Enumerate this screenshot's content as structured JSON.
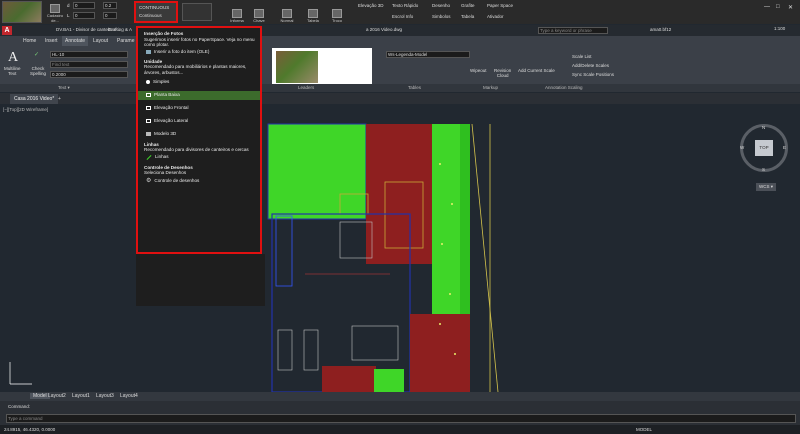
{
  "top": {
    "cmd_labels": [
      "Cadastro\nde...",
      "Mosaicos"
    ],
    "field_d": "d",
    "field_d_val": "0",
    "field_l": "L",
    "field_l_val": "0",
    "field_f": "f",
    "field_f_val": "0.2",
    "field_w": "0",
    "continuous_lines": [
      "CONTINUOUS",
      "Continuous"
    ],
    "tools": [
      "Informa",
      "Chave",
      "Normal",
      "Tabela",
      "Troco"
    ],
    "quick": [
      "Elevação 3D",
      "Texto Rápido",
      "Desenho",
      "Grafite",
      "Paper Space",
      "Escrol Info",
      "Simbolos",
      "Tabela",
      "Ativador"
    ],
    "window_controls": [
      "—",
      "□",
      "✕"
    ]
  },
  "tb2": {
    "doc_info": "DV.BA1 - Divisor de canteiro e...",
    "workspace": "Drafting & A",
    "search_placeholder": "Type a keyword or phrase",
    "user": "ama0.bf12"
  },
  "ribbon": {
    "tabs": [
      "Home",
      "Insert",
      "Annotate",
      "Layout",
      "Parame"
    ],
    "text": [
      "Multiline\nText",
      "Check\nSpelling"
    ],
    "style_fields": [
      "HL·10",
      "Find text",
      "0.2000"
    ],
    "panel_text": "Text ▾",
    "table_style": "Ws-Legenda-Model",
    "wipeout": "Wipeout",
    "revision": "Revision\nCloud",
    "add_scale": "Add Current Scale",
    "scale_items": [
      "Scale List",
      "Add/Delete Scales",
      "Sync Scale Positions"
    ],
    "panels": [
      "Leaders",
      "Tables",
      "Markup",
      "Annotation Scaling"
    ],
    "title": "a 2016 Video.dwg"
  },
  "doctab": {
    "name": "Casa 2016 Video*",
    "plus": "+"
  },
  "viewport": "[−][Top][2D Wireframe]",
  "popup": {
    "h1": "Inserção de Fotos",
    "d1": "Sugerimos inserir fotos no PaperSpace. Veja no menu como plotar.",
    "item1": "Inserir a foto do item (OLE)",
    "h2": "Unidade",
    "d2": "Recomendado para mobiliários e plantas maiores, árvores, arbustos...",
    "items": [
      "Simples",
      "Planta Baixa",
      "Elevação Frontal",
      "Elevação Lateral",
      "Modelo 3D"
    ],
    "h3": "Linhas",
    "d3": "Recomendado para divisores de canteiros e cercas",
    "line_item": "Linhas",
    "h4": "Controle de Desenhos",
    "d4": "Seleciona Desenhos",
    "item_ctrl": "Controle de desenhos"
  },
  "viewcube": {
    "n": "N",
    "s": "S",
    "e": "E",
    "w": "W",
    "top": "TOP",
    "wcs": "WCS ▾"
  },
  "scale_right": "1:100",
  "layouts": [
    "Model",
    "Layout2",
    "Layout1",
    "Layout3",
    "Layout4"
  ],
  "command": {
    "label": "Command:",
    "placeholder": "Type a command"
  },
  "status": {
    "coords": "24.8915, 46.4320, 0.0000",
    "model": "MODEL"
  },
  "colors": {
    "red": "#e01010",
    "green": "#3fd628",
    "redzone": "#8e1f1f"
  }
}
